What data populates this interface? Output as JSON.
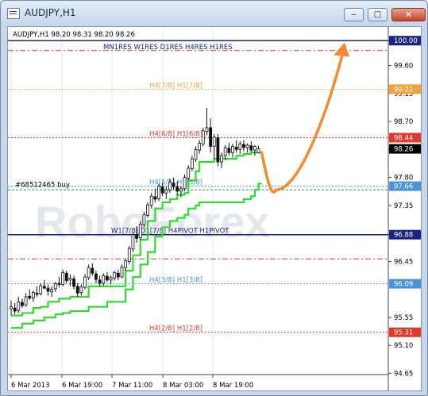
{
  "window": {
    "title": "AUDJPY,H1",
    "minimize_glyph": "‒",
    "maximize_glyph": "□",
    "close_glyph": "✕"
  },
  "chart_info": "AUDJPY,H1  98.20 98.31 98.20 98.26",
  "watermark": "RoboForex",
  "colors": {
    "grid": "#e7e7e7",
    "red": "#e23a2a",
    "orange": "#f0a33a",
    "blue": "#4b93d8",
    "navy": "#1a237e",
    "green": "#2edc2e",
    "candle": "#111111",
    "arrow": "#f58a32"
  },
  "chart_data": {
    "type": "candlestick",
    "symbol": "AUDJPY",
    "timeframe": "H1",
    "ohlc_header": [
      98.2,
      98.31,
      98.2,
      98.26
    ],
    "y_ticks": [
      100.0,
      99.6,
      99.15,
      98.7,
      98.26,
      97.8,
      97.35,
      96.88,
      96.45,
      95.55,
      95.1,
      94.65
    ],
    "ylim": [
      94.63,
      100.22
    ],
    "x_ticks": [
      "6 Mar 2013",
      "6 Mar 19:00",
      "7 Mar 11:00",
      "8 Mar 03:00",
      "8 Mar 19:00"
    ],
    "levels": [
      {
        "label": "",
        "price": 100.0,
        "tag": "100.00",
        "style": "navy-solid"
      },
      {
        "label": "MN1RES W1RES D1RES H4RES H1RES",
        "price": 99.84,
        "tag": "",
        "style": "red-dashdot"
      },
      {
        "label": "H4[7/8] H1[7/8]",
        "price": 99.22,
        "tag": "99.22",
        "style": "orange-dotted"
      },
      {
        "label": "H4[6/8] H1[6/8]",
        "price": 98.44,
        "tag": "98.44",
        "style": "red-dotted"
      },
      {
        "label": "H4[5/8] H1[5/8]",
        "price": 97.66,
        "tag": "97.66",
        "style": "blue-dotted"
      },
      {
        "label": "W1[7/8] D1[7/8] H4PIVOT H1PIVOT",
        "price": 96.88,
        "tag": "96.88",
        "style": "navy-solid"
      },
      {
        "label": "",
        "price": 96.49,
        "tag": "",
        "style": "red-dashdot"
      },
      {
        "label": "H4[3/8] H1[3/8]",
        "price": 96.09,
        "tag": "96.09",
        "style": "blue-dotted"
      },
      {
        "label": "H4[2/8] H1[2/8]",
        "price": 95.31,
        "tag": "95.31",
        "style": "red-dotted"
      }
    ],
    "current_price": 98.26,
    "order_line": {
      "label": "#68512465 buy",
      "price": 97.6
    },
    "candles": [
      [
        95.69,
        95.82,
        95.58,
        95.72
      ],
      [
        95.7,
        95.78,
        95.6,
        95.65
      ],
      [
        95.66,
        95.88,
        95.62,
        95.8
      ],
      [
        95.79,
        95.85,
        95.7,
        95.74
      ],
      [
        95.75,
        95.94,
        95.72,
        95.88
      ],
      [
        95.89,
        96.0,
        95.83,
        95.86
      ],
      [
        95.86,
        95.98,
        95.8,
        95.95
      ],
      [
        95.94,
        96.05,
        95.88,
        95.92
      ],
      [
        95.93,
        96.1,
        95.9,
        96.06
      ],
      [
        96.05,
        96.15,
        96.0,
        96.02
      ],
      [
        96.02,
        96.08,
        95.9,
        95.97
      ],
      [
        95.96,
        96.05,
        95.88,
        96.0
      ],
      [
        96.01,
        96.12,
        95.96,
        96.09
      ],
      [
        96.1,
        96.2,
        96.03,
        96.08
      ],
      [
        96.08,
        96.32,
        96.05,
        96.27
      ],
      [
        96.26,
        96.3,
        96.1,
        96.14
      ],
      [
        96.15,
        96.24,
        96.05,
        96.18
      ],
      [
        96.17,
        96.22,
        96.0,
        96.05
      ],
      [
        96.05,
        96.1,
        95.88,
        95.94
      ],
      [
        95.95,
        96.08,
        95.9,
        96.04
      ],
      [
        96.03,
        96.25,
        96.0,
        96.2
      ],
      [
        96.19,
        96.4,
        96.15,
        96.35
      ],
      [
        96.34,
        96.42,
        96.22,
        96.26
      ],
      [
        96.25,
        96.3,
        96.1,
        96.16
      ],
      [
        96.15,
        96.22,
        96.05,
        96.1
      ],
      [
        96.1,
        96.26,
        96.06,
        96.22
      ],
      [
        96.21,
        96.28,
        96.12,
        96.15
      ],
      [
        96.15,
        96.22,
        96.08,
        96.19
      ],
      [
        96.18,
        96.3,
        96.14,
        96.27
      ],
      [
        96.26,
        96.32,
        96.15,
        96.2
      ],
      [
        96.2,
        96.4,
        96.18,
        96.36
      ],
      [
        96.35,
        96.5,
        96.3,
        96.46
      ],
      [
        96.45,
        96.7,
        96.4,
        96.66
      ],
      [
        96.65,
        96.92,
        96.6,
        96.88
      ],
      [
        96.87,
        97.02,
        96.75,
        96.82
      ],
      [
        96.83,
        97.1,
        96.8,
        97.05
      ],
      [
        97.04,
        97.25,
        97.0,
        97.2
      ],
      [
        97.19,
        97.4,
        97.15,
        97.36
      ],
      [
        97.35,
        97.55,
        97.3,
        97.5
      ],
      [
        97.49,
        97.62,
        97.4,
        97.45
      ],
      [
        97.46,
        97.7,
        97.42,
        97.66
      ],
      [
        97.65,
        97.72,
        97.5,
        97.55
      ],
      [
        97.55,
        97.66,
        97.45,
        97.6
      ],
      [
        97.6,
        97.78,
        97.55,
        97.72
      ],
      [
        97.71,
        97.8,
        97.6,
        97.65
      ],
      [
        97.65,
        97.74,
        97.52,
        97.58
      ],
      [
        97.58,
        97.66,
        97.48,
        97.62
      ],
      [
        97.62,
        97.85,
        97.58,
        97.8
      ],
      [
        97.79,
        98.0,
        97.75,
        97.95
      ],
      [
        97.94,
        98.15,
        97.9,
        98.1
      ],
      [
        98.09,
        98.3,
        98.05,
        98.25
      ],
      [
        98.24,
        98.4,
        98.18,
        98.35
      ],
      [
        98.34,
        98.6,
        98.3,
        98.55
      ],
      [
        98.54,
        98.92,
        98.48,
        98.6
      ],
      [
        98.6,
        98.75,
        98.2,
        98.3
      ],
      [
        98.3,
        98.5,
        98.1,
        98.45
      ],
      [
        98.44,
        98.5,
        97.98,
        98.05
      ],
      [
        98.05,
        98.2,
        97.95,
        98.15
      ],
      [
        98.15,
        98.32,
        98.08,
        98.28
      ],
      [
        98.27,
        98.36,
        98.15,
        98.2
      ],
      [
        98.2,
        98.34,
        98.12,
        98.3
      ],
      [
        98.29,
        98.4,
        98.2,
        98.25
      ],
      [
        98.25,
        98.38,
        98.18,
        98.34
      ],
      [
        98.33,
        98.4,
        98.22,
        98.28
      ],
      [
        98.28,
        98.35,
        98.2,
        98.32
      ],
      [
        98.31,
        98.38,
        98.21,
        98.24
      ],
      [
        98.24,
        98.32,
        98.15,
        98.3
      ],
      [
        98.2,
        98.31,
        98.2,
        98.26
      ]
    ],
    "indicator_lines": [
      {
        "name": "",
        "color": "#2edc2e",
        "values": [
          95.58,
          95.58,
          95.58,
          95.62,
          95.62,
          95.62,
          95.7,
          95.7,
          95.72,
          95.72,
          95.8,
          95.8,
          95.8,
          95.85,
          95.85,
          95.85,
          95.88,
          95.88,
          95.88,
          95.88,
          95.88,
          96.05,
          96.05,
          96.05,
          96.05,
          96.05,
          96.05,
          96.05,
          96.05,
          96.05,
          96.05,
          96.3,
          96.3,
          96.55,
          96.55,
          96.8,
          96.8,
          97.1,
          97.1,
          97.3,
          97.3,
          97.4,
          97.4,
          97.45,
          97.45,
          97.52,
          97.52,
          97.55,
          97.75,
          97.75,
          97.9,
          98.05,
          98.05,
          98.05,
          98.05,
          98.1,
          98.1,
          98.1,
          98.1,
          98.1,
          98.1,
          98.15,
          98.15,
          98.18,
          98.18,
          98.2,
          98.2,
          98.2
        ]
      },
      {
        "name": "",
        "color": "#2edc2e",
        "values": [
          95.38,
          95.38,
          95.38,
          95.45,
          95.45,
          95.45,
          95.5,
          95.5,
          95.5,
          95.55,
          95.55,
          95.55,
          95.6,
          95.6,
          95.62,
          95.62,
          95.65,
          95.65,
          95.65,
          95.65,
          95.65,
          95.72,
          95.72,
          95.72,
          95.72,
          95.72,
          95.8,
          95.8,
          95.8,
          95.8,
          95.8,
          96.0,
          96.0,
          96.2,
          96.2,
          96.4,
          96.4,
          96.6,
          96.6,
          96.85,
          96.85,
          97.0,
          97.0,
          97.1,
          97.1,
          97.15,
          97.15,
          97.2,
          97.3,
          97.3,
          97.35,
          97.4,
          97.4,
          97.4,
          97.4,
          97.4,
          97.4,
          97.4,
          97.4,
          97.4,
          97.4,
          97.4,
          97.4,
          97.45,
          97.45,
          97.5,
          97.6,
          97.7
        ]
      }
    ],
    "forecast_arrow": {
      "from_price": 98.2,
      "dip_price": 97.6,
      "to_price": 99.92
    }
  }
}
